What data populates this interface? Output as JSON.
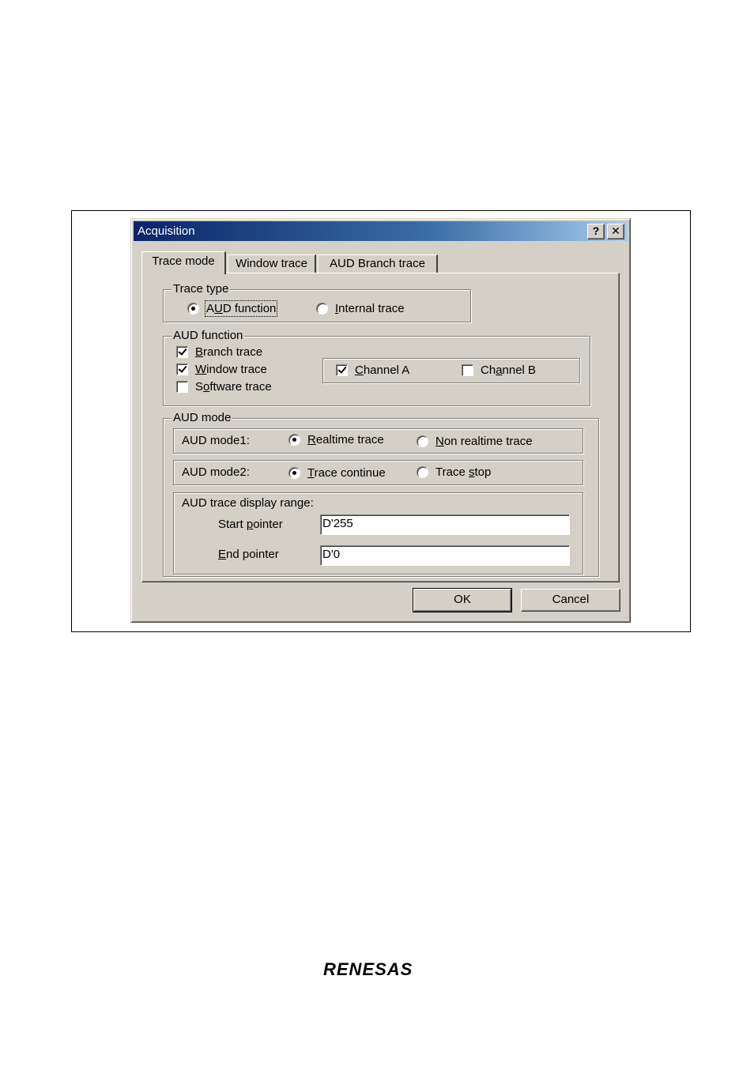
{
  "dialog": {
    "title": "Acquisition",
    "help_label": "?",
    "close_label": "✕"
  },
  "tabs": [
    {
      "label": "Trace mode",
      "active": true
    },
    {
      "label": "Window trace",
      "active": false
    },
    {
      "label": "AUD Branch trace",
      "active": false
    }
  ],
  "trace_type": {
    "label": "Trace type",
    "options": [
      {
        "prefix": "A",
        "mnemonic": "U",
        "rest": "D function",
        "selected": true
      },
      {
        "prefix": "",
        "mnemonic": "I",
        "rest": "nternal trace",
        "selected": false
      }
    ]
  },
  "aud_function": {
    "label": "AUD function",
    "checks": [
      {
        "prefix": "",
        "mnemonic": "B",
        "rest": "ranch trace",
        "checked": true
      },
      {
        "prefix": "",
        "mnemonic": "W",
        "rest": "indow trace",
        "checked": true
      },
      {
        "prefix": "S",
        "mnemonic": "o",
        "rest": "ftware trace",
        "checked": false
      }
    ],
    "channels": [
      {
        "prefix": "",
        "mnemonic": "C",
        "rest": "hannel A",
        "checked": true
      },
      {
        "prefix": "Ch",
        "mnemonic": "a",
        "rest": "nnel B",
        "checked": false
      }
    ]
  },
  "aud_mode": {
    "label": "AUD mode",
    "mode1": {
      "label": "AUD mode1:",
      "options": [
        {
          "prefix": "",
          "mnemonic": "R",
          "rest": "ealtime trace",
          "selected": true
        },
        {
          "prefix": "",
          "mnemonic": "N",
          "rest": "on realtime trace",
          "selected": false
        }
      ]
    },
    "mode2": {
      "label": "AUD mode2:",
      "options": [
        {
          "prefix": "",
          "mnemonic": "T",
          "rest": "race continue",
          "selected": true
        },
        {
          "prefix": "Trace ",
          "mnemonic": "s",
          "rest": "top",
          "selected": false
        }
      ]
    },
    "range": {
      "label": "AUD trace display range:",
      "start": {
        "prefix": "Start ",
        "mnemonic": "p",
        "rest": "ointer",
        "value": "D'255"
      },
      "end": {
        "prefix": "",
        "mnemonic": "E",
        "rest": "nd pointer",
        "value": "D'0"
      }
    }
  },
  "buttons": {
    "ok": "OK",
    "cancel": "Cancel"
  },
  "brand": {
    "name": "RENESAS"
  }
}
